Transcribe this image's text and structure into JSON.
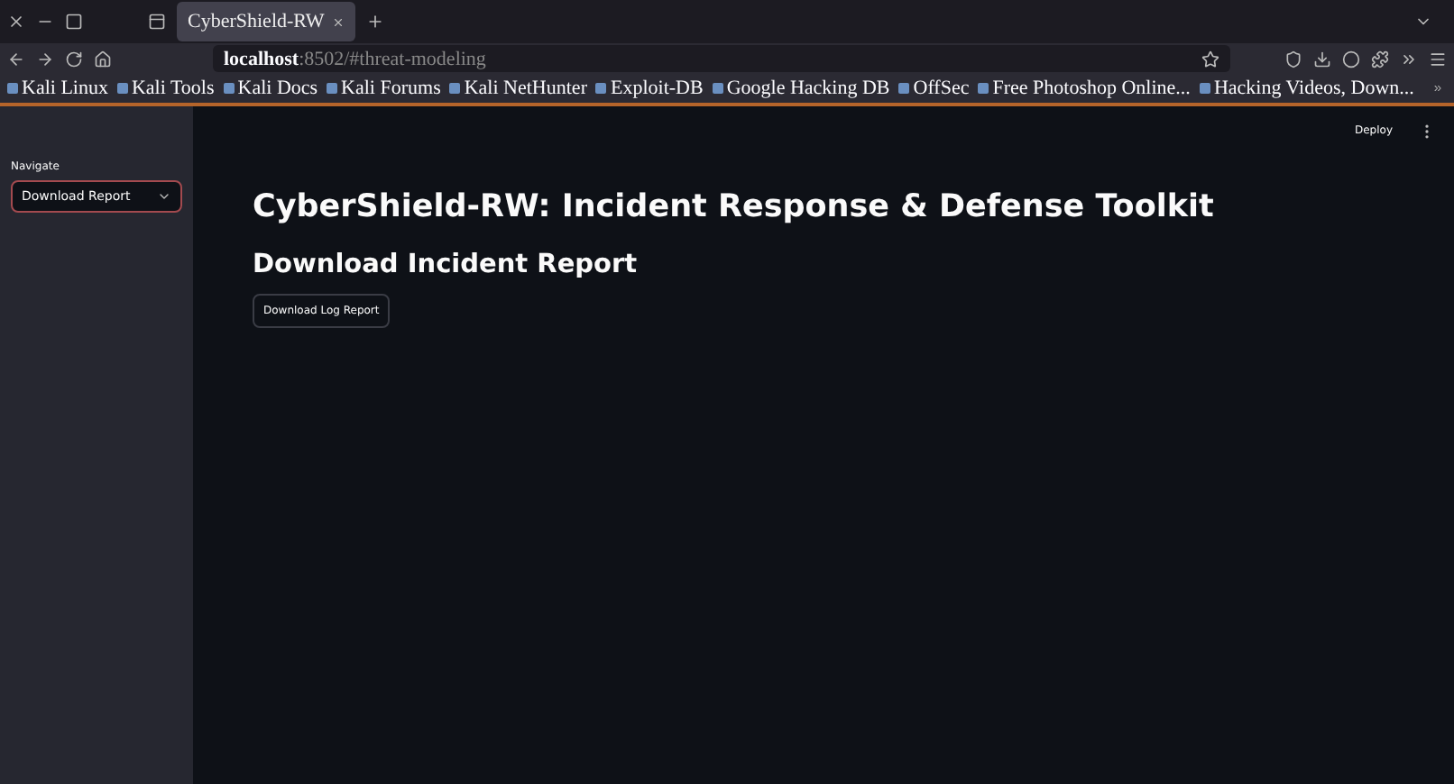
{
  "browser": {
    "tab": {
      "title": "CyberShield-RW",
      "selected": true
    },
    "address": {
      "host": "localhost",
      "rest": ":8502/#threat-modeling"
    },
    "bookmarks": [
      "Kali Linux",
      "Kali Tools",
      "Kali Docs",
      "Kali Forums",
      "Kali NetHunter",
      "Exploit-DB",
      "Google Hacking DB",
      "OffSec",
      "Free Photoshop Online...",
      "Hacking Videos, Down..."
    ]
  },
  "app": {
    "header": {
      "deploy": "Deploy"
    },
    "sidebar": {
      "label": "Navigate",
      "select_value": "Download Report"
    },
    "title": "CyberShield-RW: Incident Response & Defense Toolkit",
    "subtitle": "Download Incident Report",
    "button": "Download Log Report"
  }
}
